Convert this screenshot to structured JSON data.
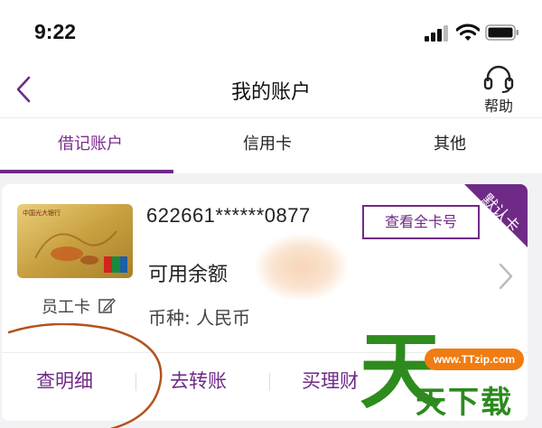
{
  "status": {
    "time": "9:22"
  },
  "header": {
    "title": "我的账户",
    "help_label": "帮助"
  },
  "tabs": [
    {
      "label": "借记账户",
      "active": true
    },
    {
      "label": "信用卡",
      "active": false
    },
    {
      "label": "其他",
      "active": false
    }
  ],
  "card": {
    "number": "622661******0877",
    "view_full_label": "查看全卡号",
    "badge": "默认卡",
    "balance_label": "可用余额",
    "currency": "币种: 人民币",
    "card_label": "员工卡",
    "bank_name_on_card": "中国光大银行",
    "actions": [
      {
        "label": "查明细"
      },
      {
        "label": "去转账"
      },
      {
        "label": "买理财"
      }
    ]
  },
  "watermark": {
    "url": "www.TTzip.com",
    "big": "天",
    "text": "天下载"
  },
  "colors": {
    "accent": "#6f2a87",
    "annotation": "#b3521e",
    "watermark_green": "#2e8b1e",
    "watermark_orange": "#f07c12"
  },
  "icons": [
    "back-chevron-icon",
    "headset-icon",
    "edit-icon",
    "chevron-right-icon",
    "signal-icon",
    "wifi-icon",
    "battery-icon"
  ]
}
